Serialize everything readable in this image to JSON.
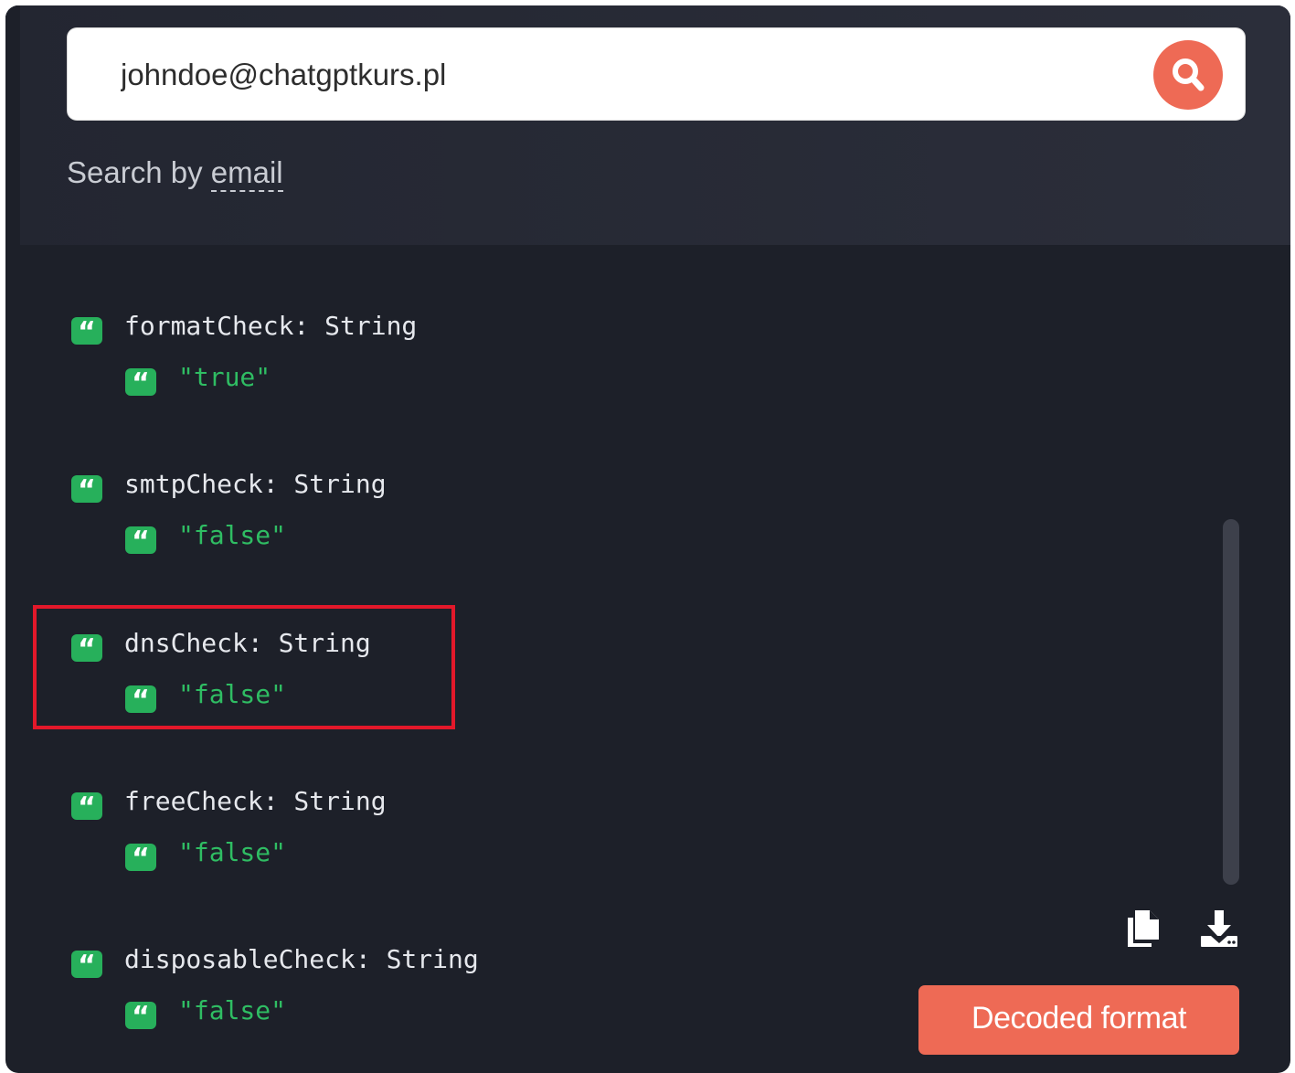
{
  "search": {
    "value": "johndoe@chatgptkurs.pl",
    "hint_prefix": "Search by ",
    "hint_term": "email"
  },
  "results": [
    {
      "name": "formatCheck: String",
      "value": "\"true\""
    },
    {
      "name": "smtpCheck: String",
      "value": "\"false\""
    },
    {
      "name": "dnsCheck: String",
      "value": "\"false\"",
      "highlighted": true
    },
    {
      "name": "freeCheck: String",
      "value": "\"false\""
    },
    {
      "name": "disposableCheck: String",
      "value": "\"false\""
    }
  ],
  "icons": {
    "field_type": "quote-icon",
    "copy": "copy-icon",
    "download": "download-icon",
    "search": "search-icon"
  },
  "actions": {
    "decoded_label": "Decoded format"
  },
  "colors": {
    "panel_background": "#1d2029",
    "accent": "#ee6a55",
    "string_green": "#2fbd63",
    "highlight_red": "#e3182a"
  }
}
